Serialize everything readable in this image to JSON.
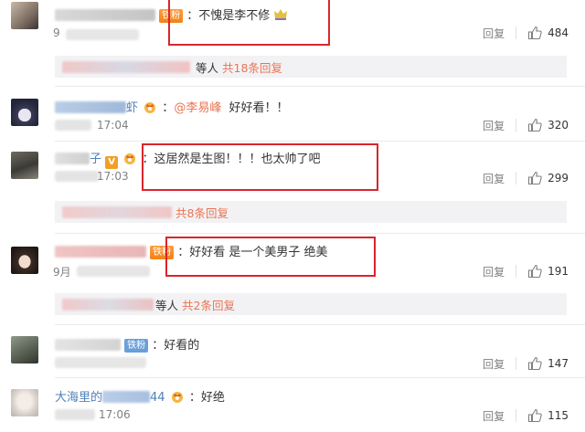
{
  "comments": [
    {
      "name_visible": "",
      "badge": "铁粉",
      "text": "：不愧是李不修",
      "time": "9",
      "reply_label": "回复",
      "likes": "484",
      "sub_reply": {
        "text": "等人",
        "link": "共18条回复"
      }
    },
    {
      "name_visible": "虾",
      "badge": "",
      "mention": "@李易峰",
      "text": "好好看！！",
      "text_prefix": "：",
      "time": "17:04",
      "reply_label": "回复",
      "likes": "320"
    },
    {
      "name_visible": "子",
      "badge": "V",
      "text": "：这居然是生图！！！也太帅了吧",
      "time": "17:03",
      "reply_label": "回复",
      "likes": "299",
      "sub_reply": {
        "text": "",
        "link": "共8条回复"
      }
    },
    {
      "name_visible": "",
      "badge": "铁粉",
      "text": "：好好看 是一个美男子 绝美",
      "time": "9月",
      "reply_label": "回复",
      "likes": "191",
      "sub_reply": {
        "text": "等人",
        "link": "共2条回复"
      }
    },
    {
      "name_visible": "",
      "badge": "铁粉",
      "text": "：好看的",
      "time": "",
      "reply_label": "回复",
      "likes": "147"
    },
    {
      "name_visible": "大海里的",
      "name_suffix": "44",
      "badge": "",
      "text": "：好绝",
      "time": "17:06",
      "reply_label": "回复",
      "likes": "115"
    }
  ],
  "colors": {
    "accent": "#eb7350",
    "highlight_box": "#d9262c",
    "meta": "#808080",
    "reply_bar": "#f2f2f5"
  },
  "icons": {
    "like": "thumbs-up-icon",
    "crown": "crown-icon",
    "verified": "v-badge-icon"
  }
}
